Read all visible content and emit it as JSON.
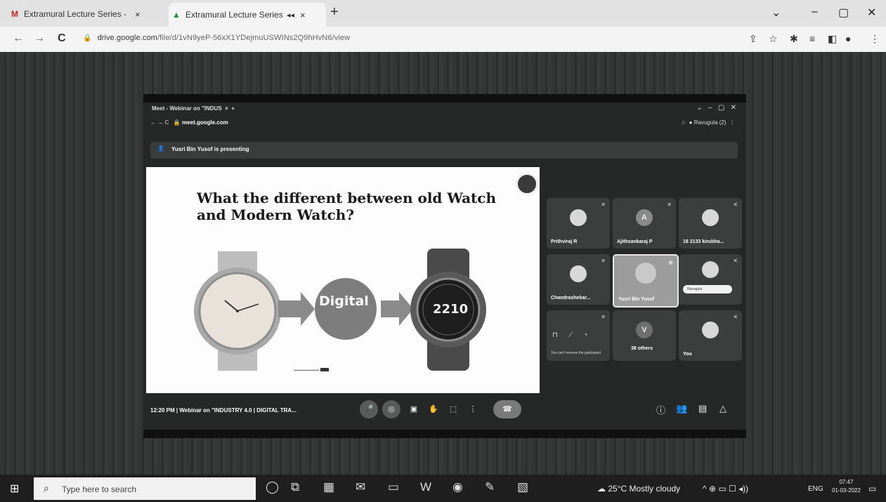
{
  "browser": {
    "tabs": [
      {
        "favicon": "gmail-icon",
        "favicon_glyph": "M",
        "title": "Extramural Lecture Series - INTC",
        "close": "×"
      },
      {
        "favicon": "google-drive-icon",
        "favicon_glyph": "▲",
        "title": "Extramural Lecture Series-I",
        "extra": "◂◂",
        "close": "×"
      }
    ],
    "new_tab": "+",
    "window": {
      "chevron": "⌄",
      "minimize": "–",
      "maximize": "▢",
      "close": "✕"
    },
    "nav": {
      "back": "←",
      "forward": "→",
      "reload": "C"
    },
    "url_host": "drive.google.com",
    "url_path": "/file/d/1vN9yeP-56xX1YDejmuUSWINs2Q9hHvN6/view",
    "toolbar_icons": [
      "share-icon",
      "bookmark-star-icon",
      "extensions-icon",
      "media-icon",
      "sidepanel-icon",
      "profile-icon",
      "menu-icon"
    ]
  },
  "meet": {
    "tab_title": "Meet - Webinar on \"INDUS",
    "url": "meet.google.com",
    "profile": "Ravugula (2)",
    "presenting_text": "Yusri Bin Yusof is presenting",
    "bottom_label": "12:20 PM  |  Webinar on \"INDUSTRY 4.0 | DIGITAL TRA...",
    "controls": [
      "microphone-icon",
      "camera-icon",
      "captions-icon",
      "hand-icon",
      "present-icon",
      "more-icon",
      "end-call-icon"
    ],
    "right_controls": [
      "info-icon",
      "people-icon",
      "chat-icon",
      "activities-icon"
    ]
  },
  "slide": {
    "title": "What the different between old Watch and Modern Watch?",
    "middle_label": "Digital",
    "watch_display": "2210"
  },
  "participants": [
    {
      "name": "Prithviraj R",
      "avatar": ""
    },
    {
      "name": "Ajithsankaraj P",
      "avatar": "A"
    },
    {
      "name": "18 2133 kirubha...",
      "avatar": ""
    },
    {
      "name": "Chandrashekar...",
      "avatar": ""
    },
    {
      "name": "Yusri Bin Yusof",
      "avatar": ""
    },
    {
      "name": "",
      "avatar": "",
      "chip": "Ravugula"
    },
    {
      "name": "",
      "avatar": "",
      "note": "You can't remove the participant"
    },
    {
      "name": "38 others",
      "avatar": "V"
    },
    {
      "name": "You",
      "avatar": ""
    }
  ],
  "taskbar": {
    "search_placeholder": "Type here to search",
    "weather": "25°C  Mostly cloudy",
    "tray": "^   ⊕  ▭  ☐  ◂))",
    "language": "ENG",
    "time": "07:47",
    "date": "01-03-2022"
  }
}
